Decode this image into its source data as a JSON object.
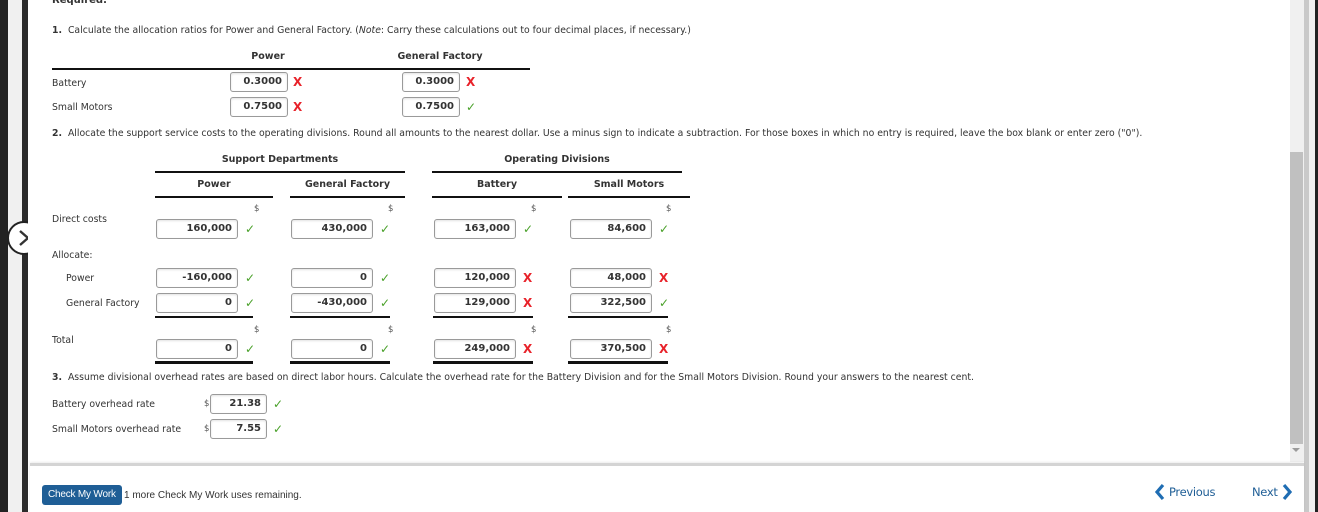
{
  "required_label": "Required:",
  "q1": {
    "number": "1.",
    "text": "Calculate the allocation ratios for Power and General Factory. (",
    "note_label": "Note",
    "note_text": ": Carry these calculations out to four decimal places, if necessary.)",
    "columns": [
      "Power",
      "General Factory"
    ],
    "rows": [
      {
        "label": "Battery",
        "values": [
          {
            "value": "0.3000",
            "status": "incorrect"
          },
          {
            "value": "0.3000",
            "status": "incorrect"
          }
        ]
      },
      {
        "label": "Small Motors",
        "values": [
          {
            "value": "0.7500",
            "status": "incorrect"
          },
          {
            "value": "0.7500",
            "status": "correct"
          }
        ]
      }
    ]
  },
  "q2": {
    "number": "2.",
    "text": "Allocate the support service costs to the operating divisions. Round all amounts to the nearest dollar. Use a minus sign to indicate a subtraction. For those boxes in which no entry is required, leave the box blank or enter zero (\"0\").",
    "group_headers": [
      "Support Departments",
      "Operating Divisions"
    ],
    "columns": [
      "Power",
      "General Factory",
      "Battery",
      "Small Motors"
    ],
    "currency_symbol": "$",
    "direct_costs_label": "Direct costs",
    "allocate_label": "Allocate:",
    "total_label": "Total",
    "direct_costs": [
      {
        "value": "160,000",
        "status": "correct"
      },
      {
        "value": "430,000",
        "status": "correct"
      },
      {
        "value": "163,000",
        "status": "correct"
      },
      {
        "value": "84,600",
        "status": "correct"
      }
    ],
    "allocate_rows": [
      {
        "label": "Power",
        "values": [
          {
            "value": "-160,000",
            "status": "correct"
          },
          {
            "value": "0",
            "status": "correct"
          },
          {
            "value": "120,000",
            "status": "incorrect"
          },
          {
            "value": "48,000",
            "status": "incorrect"
          }
        ]
      },
      {
        "label": "General Factory",
        "values": [
          {
            "value": "0",
            "status": "correct"
          },
          {
            "value": "-430,000",
            "status": "correct"
          },
          {
            "value": "129,000",
            "status": "incorrect"
          },
          {
            "value": "322,500",
            "status": "correct"
          }
        ]
      }
    ],
    "totals": [
      {
        "value": "0",
        "status": "correct"
      },
      {
        "value": "0",
        "status": "correct"
      },
      {
        "value": "249,000",
        "status": "incorrect"
      },
      {
        "value": "370,500",
        "status": "incorrect"
      }
    ]
  },
  "q3": {
    "number": "3.",
    "text": "Assume divisional overhead rates are based on direct labor hours. Calculate the overhead rate for the Battery Division and for the Small Motors Division. Round your answers to the nearest cent.",
    "currency_symbol": "$",
    "rows": [
      {
        "label": "Battery overhead rate",
        "value": "21.38",
        "status": "correct"
      },
      {
        "label": "Small Motors overhead rate",
        "value": "7.55",
        "status": "correct"
      }
    ]
  },
  "marks": {
    "correct": "✓",
    "incorrect": "X"
  },
  "footer": {
    "check_button": "Check My Work",
    "remaining_text": "1 more Check My Work uses remaining.",
    "previous_label": "Previous",
    "next_label": "Next",
    "previous_icon": "‹",
    "next_icon": "›"
  },
  "colors": {
    "correct": "#4aa12a",
    "incorrect": "#e8222a",
    "brand": "#1f5e96"
  }
}
